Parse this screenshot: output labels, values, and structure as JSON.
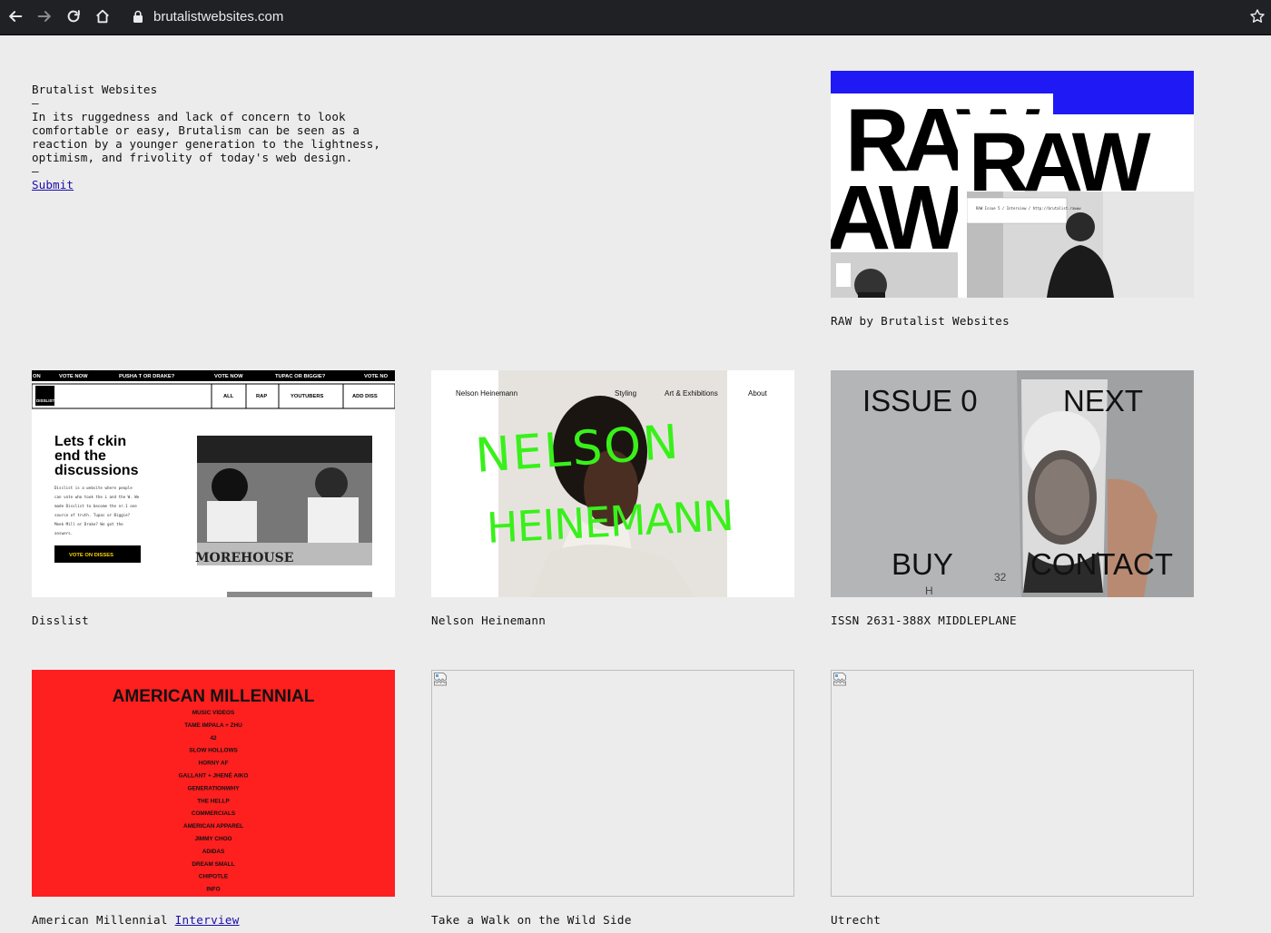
{
  "browser": {
    "url": "brutalistwebsites.com",
    "icons": [
      "back-arrow-icon",
      "forward-arrow-icon",
      "reload-icon",
      "home-icon",
      "lock-icon",
      "star-icon"
    ]
  },
  "intro": {
    "title": "Brutalist Websites",
    "dash1": "—",
    "description": "In its ruggedness and lack of concern to look\ncomfortable or easy, Brutalism can be seen as a\nreaction by a younger generation to the lightness,\noptimism, and frivolity of today's web design.",
    "dash2": "—",
    "submit_label": "Submit"
  },
  "cards": {
    "raw": {
      "caption": "RAW by Brutalist Websites",
      "shot": {
        "word": "RAW",
        "word_short": "AW",
        "small_text": "RAW Issue 5 / Interview / http://brutalist.rawww"
      }
    },
    "disslist": {
      "caption": "Disslist",
      "shot": {
        "ticker": [
          "ON",
          "VOTE NOW",
          "PUSHA T OR DRAKE?",
          "VOTE NOW",
          "TUPAC OR BIGGIE?",
          "VOTE NO"
        ],
        "logo": "DISSLIST",
        "menu": [
          "ALL",
          "RAP",
          "YOUTUBERS",
          "ADD DISS"
        ],
        "headline": [
          "Lets f ckin",
          "end the",
          "discussions"
        ],
        "body": [
          "Disslist is a website where people",
          "can vote who took the L and the W. We",
          "made Disslist to become the nr.1 one",
          "source of truth. Tupac or Biggie?",
          "Meek Mill or Drake? We got the",
          "answers."
        ],
        "cta": "VOTE ON DISSES",
        "photo_text": "MOREHOUSE"
      }
    },
    "nelson": {
      "caption": "Nelson Heinemann",
      "shot": {
        "name": "Nelson Heinemann",
        "nav": [
          "Styling",
          "Art & Exhibitions",
          "About"
        ],
        "scribble": [
          "NELSON",
          "HEINEMANN"
        ]
      }
    },
    "issn": {
      "caption": "ISSN 2631-388X MIDDLEPLANE",
      "shot": {
        "issue": "ISSUE 0",
        "next": "NEXT",
        "buy": "BUY",
        "contact": "CONTACT",
        "page_num": "32",
        "letter": "H"
      }
    },
    "american": {
      "caption": "American Millennial",
      "link": "Interview",
      "shot": {
        "title": "AMERICAN MILLENNIAL",
        "items": [
          "MUSIC VIDEOS",
          "TAME IMPALA + ZHU",
          "42",
          "SLOW HOLLOWS",
          "HORNY AF",
          "GALLANT + JHENÉ AIKO",
          "GENERATIONWHY",
          "THE HELLP",
          "COMMERCIALS",
          "AMERICAN APPAREL",
          "JIMMY CHOO",
          "ADIDAS",
          "DREAM SMALL",
          "CHIPOTLE",
          "INFO"
        ],
        "colors": {
          "bg": "#fe1f1f",
          "text": "#111111"
        }
      }
    },
    "wild": {
      "caption": "Take a Walk on the Wild Side"
    },
    "utrecht": {
      "caption": "Utrecht"
    }
  },
  "colors": {
    "page_bg": "#ececec",
    "link": "#1a0dab",
    "raw_blue": "#1f19f5",
    "nelson_green": "#39f01a"
  }
}
